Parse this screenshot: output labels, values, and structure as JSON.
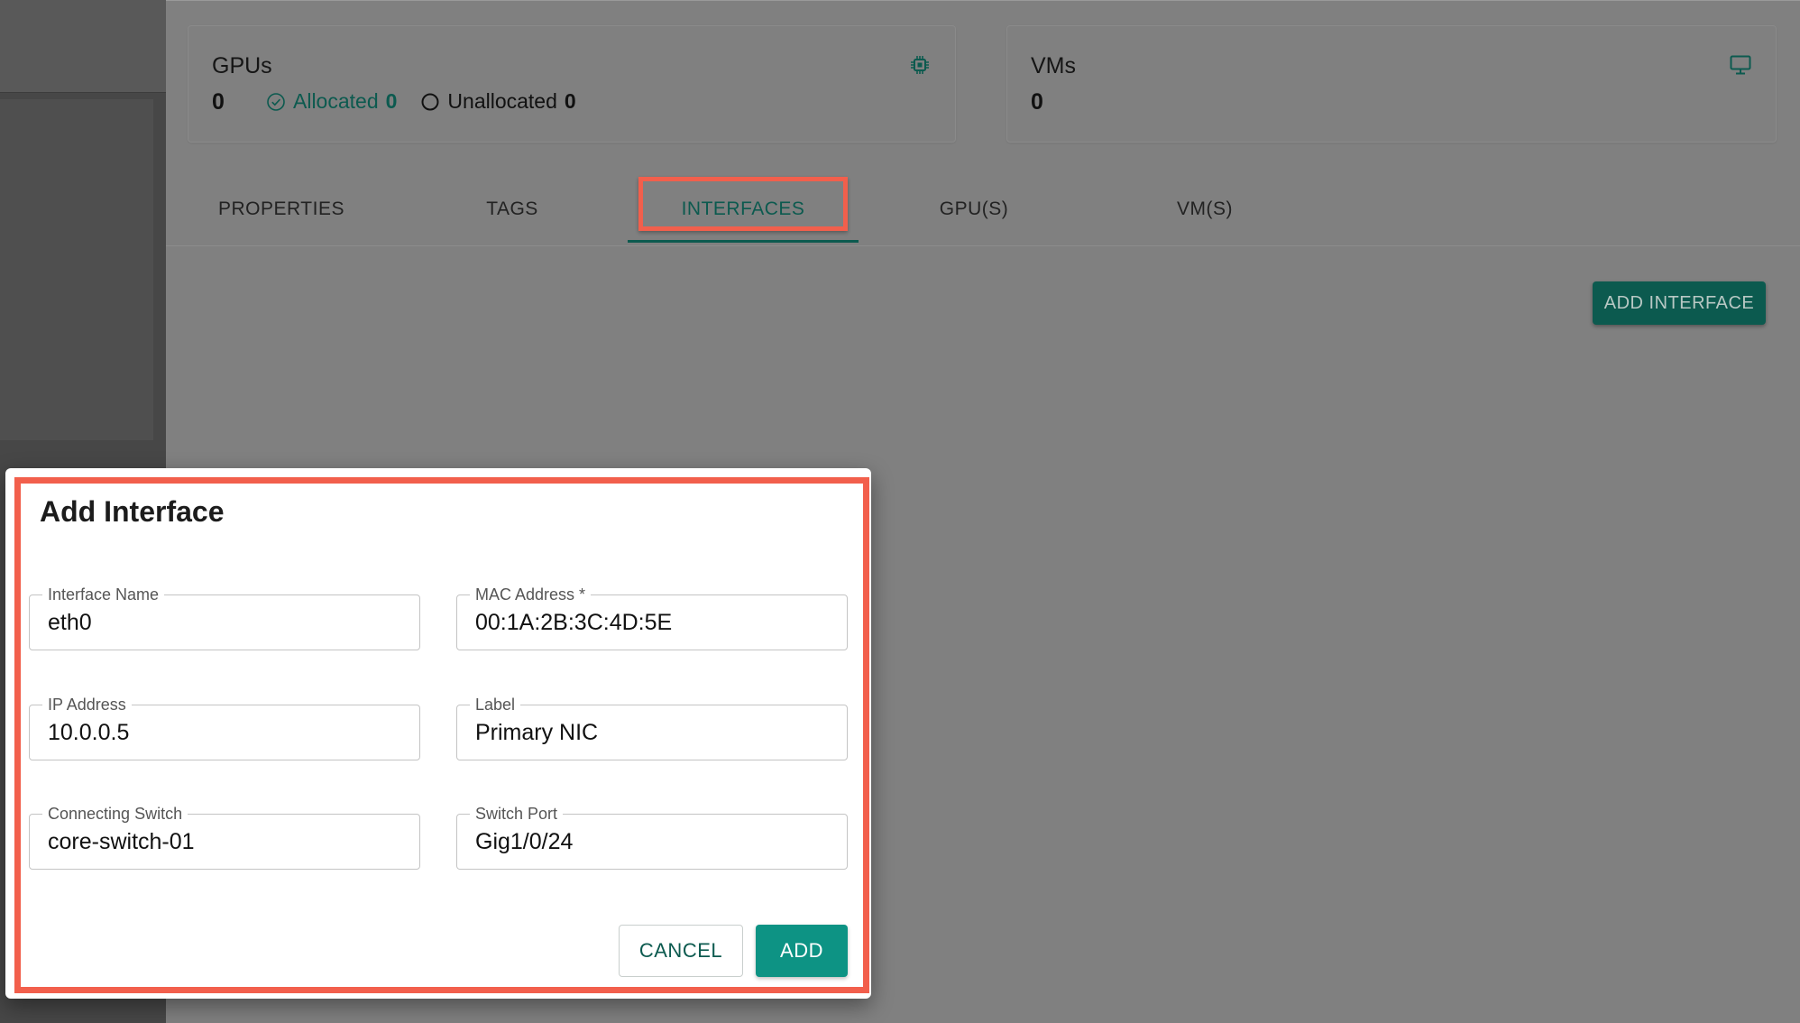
{
  "colors": {
    "accent": "#0c5a4f",
    "primary_button": "#0d9384",
    "highlight": "#f25f4c"
  },
  "cards": {
    "gpus": {
      "title": "GPUs",
      "count": "0",
      "allocated_label": "Allocated",
      "allocated_count": "0",
      "unallocated_label": "Unallocated",
      "unallocated_count": "0",
      "icon": "chip-icon"
    },
    "vms": {
      "title": "VMs",
      "count": "0",
      "icon": "monitor-icon"
    }
  },
  "tabs": [
    {
      "label": "PROPERTIES",
      "active": false
    },
    {
      "label": "TAGS",
      "active": false
    },
    {
      "label": "INTERFACES",
      "active": true
    },
    {
      "label": "GPU(S)",
      "active": false
    },
    {
      "label": "VM(S)",
      "active": false
    }
  ],
  "toolbar": {
    "add_interface_label": "ADD INTERFACE"
  },
  "dialog": {
    "title": "Add Interface",
    "fields": {
      "interface_name": {
        "label": "Interface Name",
        "value": "eth0"
      },
      "mac_address": {
        "label": "MAC Address *",
        "value": "00:1A:2B:3C:4D:5E"
      },
      "ip_address": {
        "label": "IP Address",
        "value": "10.0.0.5"
      },
      "label": {
        "label": "Label",
        "value": "Primary NIC"
      },
      "connecting_switch": {
        "label": "Connecting Switch",
        "value": "core-switch-01"
      },
      "switch_port": {
        "label": "Switch Port",
        "value": "Gig1/0/24"
      }
    },
    "cancel_label": "CANCEL",
    "add_label": "ADD"
  }
}
